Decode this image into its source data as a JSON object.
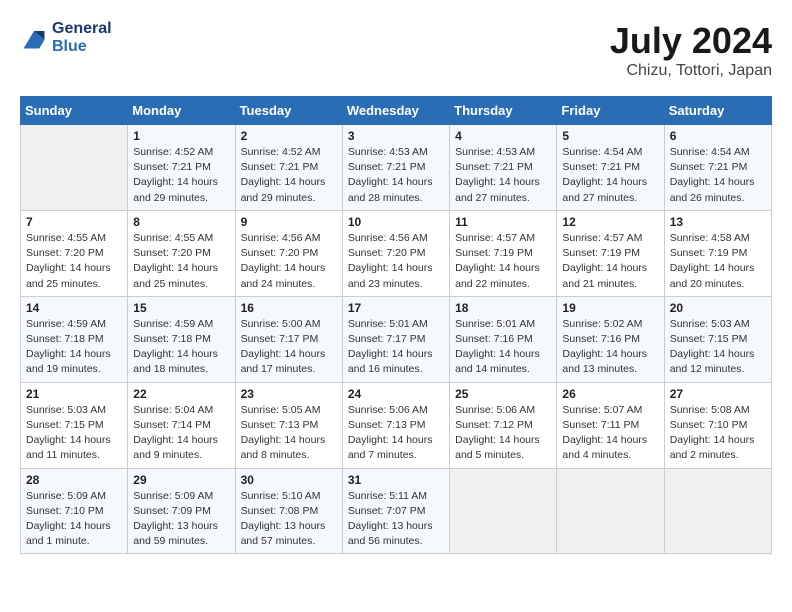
{
  "header": {
    "logo_line1": "General",
    "logo_line2": "Blue",
    "month_year": "July 2024",
    "location": "Chizu, Tottori, Japan"
  },
  "columns": [
    "Sunday",
    "Monday",
    "Tuesday",
    "Wednesday",
    "Thursday",
    "Friday",
    "Saturday"
  ],
  "weeks": [
    [
      {
        "num": "",
        "info": ""
      },
      {
        "num": "1",
        "info": "Sunrise: 4:52 AM\nSunset: 7:21 PM\nDaylight: 14 hours\nand 29 minutes."
      },
      {
        "num": "2",
        "info": "Sunrise: 4:52 AM\nSunset: 7:21 PM\nDaylight: 14 hours\nand 29 minutes."
      },
      {
        "num": "3",
        "info": "Sunrise: 4:53 AM\nSunset: 7:21 PM\nDaylight: 14 hours\nand 28 minutes."
      },
      {
        "num": "4",
        "info": "Sunrise: 4:53 AM\nSunset: 7:21 PM\nDaylight: 14 hours\nand 27 minutes."
      },
      {
        "num": "5",
        "info": "Sunrise: 4:54 AM\nSunset: 7:21 PM\nDaylight: 14 hours\nand 27 minutes."
      },
      {
        "num": "6",
        "info": "Sunrise: 4:54 AM\nSunset: 7:21 PM\nDaylight: 14 hours\nand 26 minutes."
      }
    ],
    [
      {
        "num": "7",
        "info": "Sunrise: 4:55 AM\nSunset: 7:20 PM\nDaylight: 14 hours\nand 25 minutes."
      },
      {
        "num": "8",
        "info": "Sunrise: 4:55 AM\nSunset: 7:20 PM\nDaylight: 14 hours\nand 25 minutes."
      },
      {
        "num": "9",
        "info": "Sunrise: 4:56 AM\nSunset: 7:20 PM\nDaylight: 14 hours\nand 24 minutes."
      },
      {
        "num": "10",
        "info": "Sunrise: 4:56 AM\nSunset: 7:20 PM\nDaylight: 14 hours\nand 23 minutes."
      },
      {
        "num": "11",
        "info": "Sunrise: 4:57 AM\nSunset: 7:19 PM\nDaylight: 14 hours\nand 22 minutes."
      },
      {
        "num": "12",
        "info": "Sunrise: 4:57 AM\nSunset: 7:19 PM\nDaylight: 14 hours\nand 21 minutes."
      },
      {
        "num": "13",
        "info": "Sunrise: 4:58 AM\nSunset: 7:19 PM\nDaylight: 14 hours\nand 20 minutes."
      }
    ],
    [
      {
        "num": "14",
        "info": "Sunrise: 4:59 AM\nSunset: 7:18 PM\nDaylight: 14 hours\nand 19 minutes."
      },
      {
        "num": "15",
        "info": "Sunrise: 4:59 AM\nSunset: 7:18 PM\nDaylight: 14 hours\nand 18 minutes."
      },
      {
        "num": "16",
        "info": "Sunrise: 5:00 AM\nSunset: 7:17 PM\nDaylight: 14 hours\nand 17 minutes."
      },
      {
        "num": "17",
        "info": "Sunrise: 5:01 AM\nSunset: 7:17 PM\nDaylight: 14 hours\nand 16 minutes."
      },
      {
        "num": "18",
        "info": "Sunrise: 5:01 AM\nSunset: 7:16 PM\nDaylight: 14 hours\nand 14 minutes."
      },
      {
        "num": "19",
        "info": "Sunrise: 5:02 AM\nSunset: 7:16 PM\nDaylight: 14 hours\nand 13 minutes."
      },
      {
        "num": "20",
        "info": "Sunrise: 5:03 AM\nSunset: 7:15 PM\nDaylight: 14 hours\nand 12 minutes."
      }
    ],
    [
      {
        "num": "21",
        "info": "Sunrise: 5:03 AM\nSunset: 7:15 PM\nDaylight: 14 hours\nand 11 minutes."
      },
      {
        "num": "22",
        "info": "Sunrise: 5:04 AM\nSunset: 7:14 PM\nDaylight: 14 hours\nand 9 minutes."
      },
      {
        "num": "23",
        "info": "Sunrise: 5:05 AM\nSunset: 7:13 PM\nDaylight: 14 hours\nand 8 minutes."
      },
      {
        "num": "24",
        "info": "Sunrise: 5:06 AM\nSunset: 7:13 PM\nDaylight: 14 hours\nand 7 minutes."
      },
      {
        "num": "25",
        "info": "Sunrise: 5:06 AM\nSunset: 7:12 PM\nDaylight: 14 hours\nand 5 minutes."
      },
      {
        "num": "26",
        "info": "Sunrise: 5:07 AM\nSunset: 7:11 PM\nDaylight: 14 hours\nand 4 minutes."
      },
      {
        "num": "27",
        "info": "Sunrise: 5:08 AM\nSunset: 7:10 PM\nDaylight: 14 hours\nand 2 minutes."
      }
    ],
    [
      {
        "num": "28",
        "info": "Sunrise: 5:09 AM\nSunset: 7:10 PM\nDaylight: 14 hours\nand 1 minute."
      },
      {
        "num": "29",
        "info": "Sunrise: 5:09 AM\nSunset: 7:09 PM\nDaylight: 13 hours\nand 59 minutes."
      },
      {
        "num": "30",
        "info": "Sunrise: 5:10 AM\nSunset: 7:08 PM\nDaylight: 13 hours\nand 57 minutes."
      },
      {
        "num": "31",
        "info": "Sunrise: 5:11 AM\nSunset: 7:07 PM\nDaylight: 13 hours\nand 56 minutes."
      },
      {
        "num": "",
        "info": ""
      },
      {
        "num": "",
        "info": ""
      },
      {
        "num": "",
        "info": ""
      }
    ]
  ]
}
